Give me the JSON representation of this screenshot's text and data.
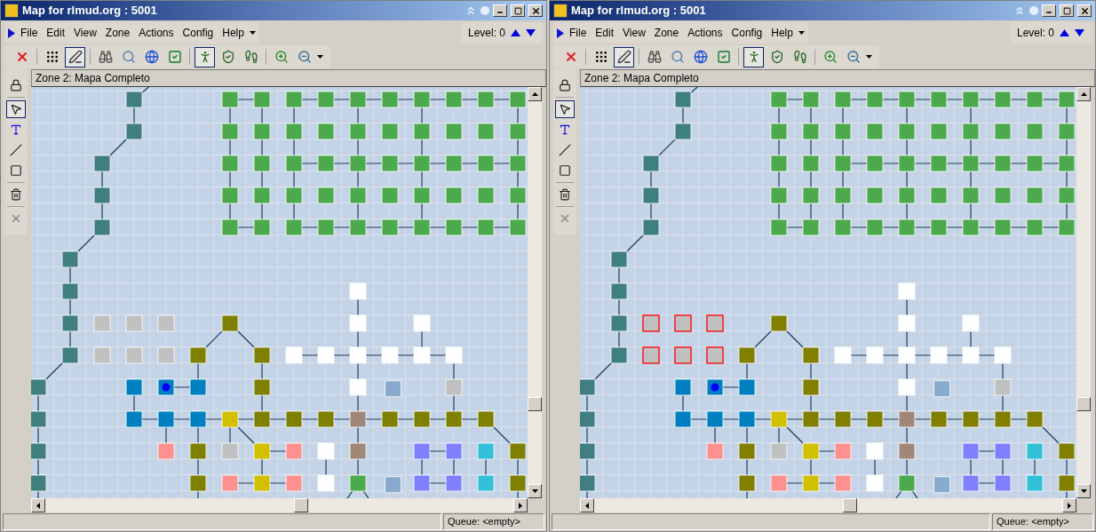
{
  "windows": [
    {
      "title": "Map for rlmud.org : 5001",
      "menu": [
        "File",
        "Edit",
        "View",
        "Zone",
        "Actions",
        "Config",
        "Help"
      ],
      "level": "Level: 0",
      "toolbar": [
        {
          "selected": false
        },
        {
          "selected": false
        },
        {
          "selected": true
        },
        {
          "selected": false
        },
        {
          "selected": false
        },
        {
          "selected": false
        },
        {
          "selected": false
        },
        {
          "selected": true
        },
        {
          "selected": false
        },
        {
          "selected": false
        },
        {
          "selected": false
        },
        {
          "selected": false
        }
      ],
      "tools": [
        {
          "selected": false,
          "disabled": false
        },
        {
          "selected": true,
          "disabled": false
        },
        {
          "selected": false,
          "disabled": false
        },
        {
          "selected": false,
          "disabled": false
        },
        {
          "selected": false,
          "disabled": false
        },
        {
          "selected": false,
          "disabled": false
        },
        {
          "selected": false,
          "disabled": true
        }
      ],
      "zone": "Zone 2: Mapa Completo",
      "status": "Queue: <empty>",
      "map": {
        "rooms": [
          {
            "color": "#3f7f7f",
            "selected": false
          },
          {
            "color": "#3f7f7f",
            "selected": false
          },
          {
            "color": "#3f7f7f",
            "selected": false
          },
          {
            "color": "#3f7f7f",
            "selected": false
          },
          {
            "color": "#3f7f7f",
            "selected": false
          },
          {
            "color": "#3f7f7f",
            "selected": false
          },
          {
            "color": "#3f7f7f",
            "selected": false
          },
          {
            "color": "#3f7f7f",
            "selected": false
          },
          {
            "color": "#3f7f7f",
            "selected": false
          },
          {
            "color": "#3f7f7f",
            "selected": false
          },
          {
            "color": "#3f7f7f",
            "selected": false
          },
          {
            "color": "#3f7f7f",
            "selected": false
          },
          {
            "color": "#3f7f7f",
            "selected": false
          },
          {
            "color": "#4caa4c",
            "selected": false
          },
          {
            "color": "#4caa4c",
            "selected": false
          },
          {
            "color": "#4caa4c",
            "selected": false
          },
          {
            "color": "#4caa4c",
            "selected": false
          },
          {
            "color": "#4caa4c",
            "selected": false
          },
          {
            "color": "#4caa4c",
            "selected": false
          },
          {
            "color": "#4caa4c",
            "selected": false
          },
          {
            "color": "#4caa4c",
            "selected": false
          },
          {
            "color": "#4caa4c",
            "selected": false
          },
          {
            "color": "#4caa4c",
            "selected": false
          },
          {
            "color": "#4caa4c",
            "selected": false
          },
          {
            "color": "#4caa4c",
            "selected": false
          },
          {
            "color": "#4caa4c",
            "selected": false
          },
          {
            "color": "#4caa4c",
            "selected": false
          },
          {
            "color": "#4caa4c",
            "selected": false
          },
          {
            "color": "#4caa4c",
            "selected": false
          },
          {
            "color": "#4caa4c",
            "selected": false
          },
          {
            "color": "#4caa4c",
            "selected": false
          },
          {
            "color": "#4caa4c",
            "selected": false
          },
          {
            "color": "#4caa4c",
            "selected": false
          },
          {
            "color": "#4caa4c",
            "selected": false
          },
          {
            "color": "#4caa4c",
            "selected": false
          },
          {
            "color": "#4caa4c",
            "selected": false
          },
          {
            "color": "#4caa4c",
            "selected": false
          },
          {
            "color": "#4caa4c",
            "selected": false
          },
          {
            "color": "#4caa4c",
            "selected": false
          },
          {
            "color": "#4caa4c",
            "selected": false
          },
          {
            "color": "#4caa4c",
            "selected": false
          },
          {
            "color": "#4caa4c",
            "selected": false
          },
          {
            "color": "#4caa4c",
            "selected": false
          },
          {
            "color": "#4caa4c",
            "selected": false
          },
          {
            "color": "#4caa4c",
            "selected": false
          },
          {
            "color": "#4caa4c",
            "selected": false
          },
          {
            "color": "#4caa4c",
            "selected": false
          },
          {
            "color": "#4caa4c",
            "selected": false
          },
          {
            "color": "#4caa4c",
            "selected": false
          },
          {
            "color": "#4caa4c",
            "selected": false
          },
          {
            "color": "#4caa4c",
            "selected": false
          },
          {
            "color": "#4caa4c",
            "selected": false
          },
          {
            "color": "#4caa4c",
            "selected": false
          },
          {
            "color": "#4caa4c",
            "selected": false
          },
          {
            "color": "#4caa4c",
            "selected": false
          },
          {
            "color": "#4caa4c",
            "selected": false
          },
          {
            "color": "#4caa4c",
            "selected": false
          },
          {
            "color": "#4caa4c",
            "selected": false
          },
          {
            "color": "#4caa4c",
            "selected": false
          },
          {
            "color": "#4caa4c",
            "selected": false
          },
          {
            "color": "#4caa4c",
            "selected": false
          },
          {
            "color": "#4caa4c",
            "selected": false
          },
          {
            "color": "#4caa4c",
            "selected": false
          },
          {
            "color": "#c0c0c0",
            "selected": false
          },
          {
            "color": "#c0c0c0",
            "selected": false
          },
          {
            "color": "#c0c0c0",
            "selected": false
          },
          {
            "color": "#c0c0c0",
            "selected": false
          },
          {
            "color": "#c0c0c0",
            "selected": false
          },
          {
            "color": "#c0c0c0",
            "selected": false
          },
          {
            "color": "#ffffff",
            "selected": false
          },
          {
            "color": "#808000",
            "selected": false
          },
          {
            "color": "#ffffff",
            "selected": false
          },
          {
            "color": "#ffffff",
            "selected": false
          },
          {
            "color": "#808000",
            "selected": false
          },
          {
            "color": "#808000",
            "selected": false
          },
          {
            "color": "#ffffff",
            "selected": false
          },
          {
            "color": "#ffffff",
            "selected": false
          },
          {
            "color": "#ffffff",
            "selected": false
          },
          {
            "color": "#ffffff",
            "selected": false
          },
          {
            "color": "#ffffff",
            "selected": false
          },
          {
            "color": "#ffffff",
            "selected": false
          },
          {
            "color": "#0080c0",
            "selected": false
          },
          {
            "color": "#0080c0",
            "selected": false,
            "current": true
          },
          {
            "color": "#0080c0",
            "selected": false
          },
          {
            "color": "#808000",
            "selected": false
          },
          {
            "color": "#ffffff",
            "selected": false
          },
          {
            "color": "#88aacc",
            "selected": false
          },
          {
            "color": "#c0c0c0",
            "selected": false
          },
          {
            "color": "#0080c0",
            "selected": false
          },
          {
            "color": "#0080c0",
            "selected": false
          },
          {
            "color": "#0080c0",
            "selected": false
          },
          {
            "color": "#d0c000",
            "selected": false
          },
          {
            "color": "#808000",
            "selected": false
          },
          {
            "color": "#808000",
            "selected": false
          },
          {
            "color": "#808000",
            "selected": false
          },
          {
            "color": "#a08878",
            "selected": false
          },
          {
            "color": "#808000",
            "selected": false
          },
          {
            "color": "#808000",
            "selected": false
          },
          {
            "color": "#808000",
            "selected": false
          },
          {
            "color": "#808000",
            "selected": false
          },
          {
            "color": "#ff9090",
            "selected": false
          },
          {
            "color": "#808000",
            "selected": false
          },
          {
            "color": "#c0c0c0",
            "selected": false
          },
          {
            "color": "#d0c000",
            "selected": false
          },
          {
            "color": "#ff9090",
            "selected": false
          },
          {
            "color": "#ffffff",
            "selected": false
          },
          {
            "color": "#a08878",
            "selected": false
          },
          {
            "color": "#8080ff",
            "selected": false
          },
          {
            "color": "#8080ff",
            "selected": false
          },
          {
            "color": "#30c0d8",
            "selected": false
          },
          {
            "color": "#808000",
            "selected": false
          },
          {
            "color": "#808000",
            "selected": false
          },
          {
            "color": "#ff9090",
            "selected": false
          },
          {
            "color": "#d0c000",
            "selected": false
          },
          {
            "color": "#ff9090",
            "selected": false
          },
          {
            "color": "#ffffff",
            "selected": false
          },
          {
            "color": "#4caa4c",
            "selected": false
          },
          {
            "color": "#88aacc",
            "selected": false
          },
          {
            "color": "#8080ff",
            "selected": false
          },
          {
            "color": "#8080ff",
            "selected": false
          },
          {
            "color": "#30c0d8",
            "selected": false
          },
          {
            "color": "#808000",
            "selected": false
          }
        ]
      }
    },
    {
      "title": "Map for rlmud.org : 5001",
      "menu": [
        "File",
        "Edit",
        "View",
        "Zone",
        "Actions",
        "Config",
        "Help"
      ],
      "level": "Level: 0",
      "toolbar": [
        {
          "selected": false
        },
        {
          "selected": false
        },
        {
          "selected": true
        },
        {
          "selected": false
        },
        {
          "selected": false
        },
        {
          "selected": false
        },
        {
          "selected": false
        },
        {
          "selected": true
        },
        {
          "selected": false
        },
        {
          "selected": false
        },
        {
          "selected": false
        },
        {
          "selected": false
        }
      ],
      "tools": [
        {
          "selected": false,
          "disabled": false
        },
        {
          "selected": true,
          "disabled": false
        },
        {
          "selected": false,
          "disabled": false
        },
        {
          "selected": false,
          "disabled": false
        },
        {
          "selected": false,
          "disabled": false
        },
        {
          "selected": false,
          "disabled": false
        },
        {
          "selected": false,
          "disabled": true
        }
      ],
      "zone": "Zone 2: Mapa Completo",
      "status": "Queue: <empty>",
      "map": {
        "rooms": [
          {
            "color": "#3f7f7f",
            "selected": false
          },
          {
            "color": "#3f7f7f",
            "selected": false
          },
          {
            "color": "#3f7f7f",
            "selected": false
          },
          {
            "color": "#3f7f7f",
            "selected": false
          },
          {
            "color": "#3f7f7f",
            "selected": false
          },
          {
            "color": "#3f7f7f",
            "selected": false
          },
          {
            "color": "#3f7f7f",
            "selected": false
          },
          {
            "color": "#3f7f7f",
            "selected": false
          },
          {
            "color": "#3f7f7f",
            "selected": false
          },
          {
            "color": "#3f7f7f",
            "selected": false
          },
          {
            "color": "#3f7f7f",
            "selected": false
          },
          {
            "color": "#3f7f7f",
            "selected": false
          },
          {
            "color": "#3f7f7f",
            "selected": false
          },
          {
            "color": "#4caa4c",
            "selected": false
          },
          {
            "color": "#4caa4c",
            "selected": false
          },
          {
            "color": "#4caa4c",
            "selected": false
          },
          {
            "color": "#4caa4c",
            "selected": false
          },
          {
            "color": "#4caa4c",
            "selected": false
          },
          {
            "color": "#4caa4c",
            "selected": false
          },
          {
            "color": "#4caa4c",
            "selected": false
          },
          {
            "color": "#4caa4c",
            "selected": false
          },
          {
            "color": "#4caa4c",
            "selected": false
          },
          {
            "color": "#4caa4c",
            "selected": false
          },
          {
            "color": "#4caa4c",
            "selected": false
          },
          {
            "color": "#4caa4c",
            "selected": false
          },
          {
            "color": "#4caa4c",
            "selected": false
          },
          {
            "color": "#4caa4c",
            "selected": false
          },
          {
            "color": "#4caa4c",
            "selected": false
          },
          {
            "color": "#4caa4c",
            "selected": false
          },
          {
            "color": "#4caa4c",
            "selected": false
          },
          {
            "color": "#4caa4c",
            "selected": false
          },
          {
            "color": "#4caa4c",
            "selected": false
          },
          {
            "color": "#4caa4c",
            "selected": false
          },
          {
            "color": "#4caa4c",
            "selected": false
          },
          {
            "color": "#4caa4c",
            "selected": false
          },
          {
            "color": "#4caa4c",
            "selected": false
          },
          {
            "color": "#4caa4c",
            "selected": false
          },
          {
            "color": "#4caa4c",
            "selected": false
          },
          {
            "color": "#4caa4c",
            "selected": false
          },
          {
            "color": "#4caa4c",
            "selected": false
          },
          {
            "color": "#4caa4c",
            "selected": false
          },
          {
            "color": "#4caa4c",
            "selected": false
          },
          {
            "color": "#4caa4c",
            "selected": false
          },
          {
            "color": "#4caa4c",
            "selected": false
          },
          {
            "color": "#4caa4c",
            "selected": false
          },
          {
            "color": "#4caa4c",
            "selected": false
          },
          {
            "color": "#4caa4c",
            "selected": false
          },
          {
            "color": "#4caa4c",
            "selected": false
          },
          {
            "color": "#4caa4c",
            "selected": false
          },
          {
            "color": "#4caa4c",
            "selected": false
          },
          {
            "color": "#4caa4c",
            "selected": false
          },
          {
            "color": "#4caa4c",
            "selected": false
          },
          {
            "color": "#4caa4c",
            "selected": false
          },
          {
            "color": "#4caa4c",
            "selected": false
          },
          {
            "color": "#4caa4c",
            "selected": false
          },
          {
            "color": "#4caa4c",
            "selected": false
          },
          {
            "color": "#4caa4c",
            "selected": false
          },
          {
            "color": "#4caa4c",
            "selected": false
          },
          {
            "color": "#4caa4c",
            "selected": false
          },
          {
            "color": "#4caa4c",
            "selected": false
          },
          {
            "color": "#4caa4c",
            "selected": false
          },
          {
            "color": "#4caa4c",
            "selected": false
          },
          {
            "color": "#4caa4c",
            "selected": false
          },
          {
            "color": "#c0c0c0",
            "selected": true
          },
          {
            "color": "#c0c0c0",
            "selected": true
          },
          {
            "color": "#c0c0c0",
            "selected": true
          },
          {
            "color": "#c0c0c0",
            "selected": true
          },
          {
            "color": "#c0c0c0",
            "selected": true
          },
          {
            "color": "#c0c0c0",
            "selected": true
          },
          {
            "color": "#ffffff",
            "selected": false
          },
          {
            "color": "#808000",
            "selected": false
          },
          {
            "color": "#ffffff",
            "selected": false
          },
          {
            "color": "#ffffff",
            "selected": false
          },
          {
            "color": "#808000",
            "selected": false
          },
          {
            "color": "#808000",
            "selected": false
          },
          {
            "color": "#ffffff",
            "selected": false
          },
          {
            "color": "#ffffff",
            "selected": false
          },
          {
            "color": "#ffffff",
            "selected": false
          },
          {
            "color": "#ffffff",
            "selected": false
          },
          {
            "color": "#ffffff",
            "selected": false
          },
          {
            "color": "#ffffff",
            "selected": false
          },
          {
            "color": "#0080c0",
            "selected": false
          },
          {
            "color": "#0080c0",
            "selected": false,
            "current": true
          },
          {
            "color": "#0080c0",
            "selected": false
          },
          {
            "color": "#808000",
            "selected": false
          },
          {
            "color": "#ffffff",
            "selected": false
          },
          {
            "color": "#88aacc",
            "selected": false
          },
          {
            "color": "#c0c0c0",
            "selected": false
          },
          {
            "color": "#0080c0",
            "selected": false
          },
          {
            "color": "#0080c0",
            "selected": false
          },
          {
            "color": "#0080c0",
            "selected": false
          },
          {
            "color": "#d0c000",
            "selected": false
          },
          {
            "color": "#808000",
            "selected": false
          },
          {
            "color": "#808000",
            "selected": false
          },
          {
            "color": "#808000",
            "selected": false
          },
          {
            "color": "#a08878",
            "selected": false
          },
          {
            "color": "#808000",
            "selected": false
          },
          {
            "color": "#808000",
            "selected": false
          },
          {
            "color": "#808000",
            "selected": false
          },
          {
            "color": "#808000",
            "selected": false
          },
          {
            "color": "#ff9090",
            "selected": false
          },
          {
            "color": "#808000",
            "selected": false
          },
          {
            "color": "#c0c0c0",
            "selected": false
          },
          {
            "color": "#d0c000",
            "selected": false
          },
          {
            "color": "#ff9090",
            "selected": false
          },
          {
            "color": "#ffffff",
            "selected": false
          },
          {
            "color": "#a08878",
            "selected": false
          },
          {
            "color": "#8080ff",
            "selected": false
          },
          {
            "color": "#8080ff",
            "selected": false
          },
          {
            "color": "#30c0d8",
            "selected": false
          },
          {
            "color": "#808000",
            "selected": false
          },
          {
            "color": "#808000",
            "selected": false
          },
          {
            "color": "#ff9090",
            "selected": false
          },
          {
            "color": "#d0c000",
            "selected": false
          },
          {
            "color": "#ff9090",
            "selected": false
          },
          {
            "color": "#ffffff",
            "selected": false
          },
          {
            "color": "#4caa4c",
            "selected": false
          },
          {
            "color": "#88aacc",
            "selected": false
          },
          {
            "color": "#8080ff",
            "selected": false
          },
          {
            "color": "#8080ff",
            "selected": false
          },
          {
            "color": "#30c0d8",
            "selected": false
          },
          {
            "color": "#808000",
            "selected": false
          }
        ]
      }
    }
  ]
}
